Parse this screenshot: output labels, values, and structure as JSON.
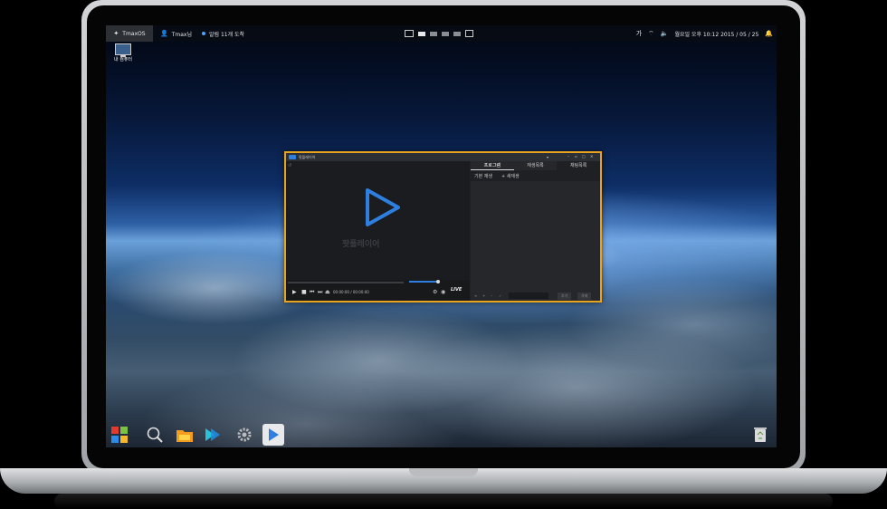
{
  "taskbar": {
    "start_label": "TmaxOS",
    "user_label": "Tmax님",
    "notification_label": "알림 11개 도착",
    "lang_indicator": "가",
    "datetime": "월요일 오후 10:12  2015 / 05 / 25"
  },
  "desktop": {
    "icons": [
      {
        "label": "내 컴퓨터",
        "icon": "computer-icon"
      }
    ]
  },
  "player": {
    "title": "팟플레이어",
    "brand": "팟플레이어",
    "time_display": "00:00:00 / 00:00:00",
    "live_badge": "LIVE",
    "titlebar_menu": "▾",
    "side_tabs": [
      "프로그램",
      "재생목록",
      "채팅목록"
    ],
    "playlist_header": "기본 재생",
    "add_playlist": "+ 새재생",
    "bottom_buttons": [
      "추가",
      "삭제"
    ]
  },
  "dock": {
    "items": [
      {
        "name": "start-menu",
        "icon": "windows-grid-icon"
      },
      {
        "name": "search",
        "icon": "search-icon"
      },
      {
        "name": "file-manager",
        "icon": "folder-icon"
      },
      {
        "name": "app-store",
        "icon": "arrow-app-icon"
      },
      {
        "name": "settings",
        "icon": "gear-icon"
      },
      {
        "name": "media-player",
        "icon": "play-icon"
      }
    ],
    "trash": {
      "icon": "recycle-bin-icon"
    }
  },
  "colors": {
    "accent": "#e8a41e",
    "player_blue": "#2f7fe0"
  }
}
